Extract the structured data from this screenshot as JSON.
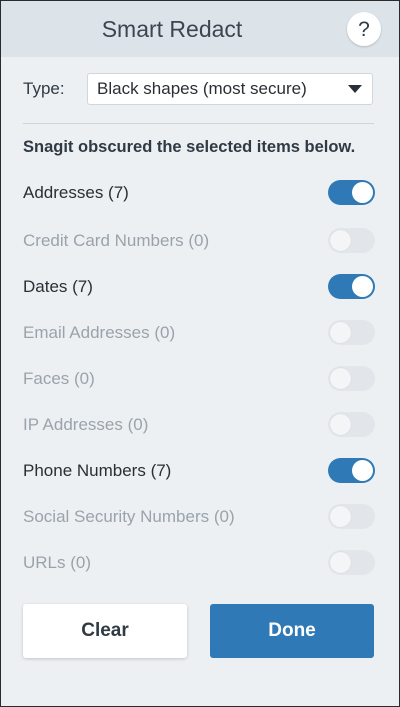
{
  "app": {
    "title": "Smart Redact",
    "help_label": "?"
  },
  "type": {
    "label": "Type:",
    "selected": "Black shapes (most secure)"
  },
  "intro": "Snagit obscured the selected items below.",
  "items": [
    {
      "label": "Addresses (7)",
      "enabled": true
    },
    {
      "label": "Credit Card Numbers (0)",
      "enabled": false
    },
    {
      "label": "Dates (7)",
      "enabled": true
    },
    {
      "label": "Email Addresses (0)",
      "enabled": false
    },
    {
      "label": "Faces (0)",
      "enabled": false
    },
    {
      "label": "IP Addresses (0)",
      "enabled": false
    },
    {
      "label": "Phone Numbers (7)",
      "enabled": true
    },
    {
      "label": "Social Security Numbers (0)",
      "enabled": false
    },
    {
      "label": "URLs (0)",
      "enabled": false
    }
  ],
  "buttons": {
    "clear": "Clear",
    "done": "Done"
  },
  "colors": {
    "accent": "#2f7ab6",
    "toggle_off": "#e2e6ea",
    "muted_text": "#9aa3ab"
  }
}
